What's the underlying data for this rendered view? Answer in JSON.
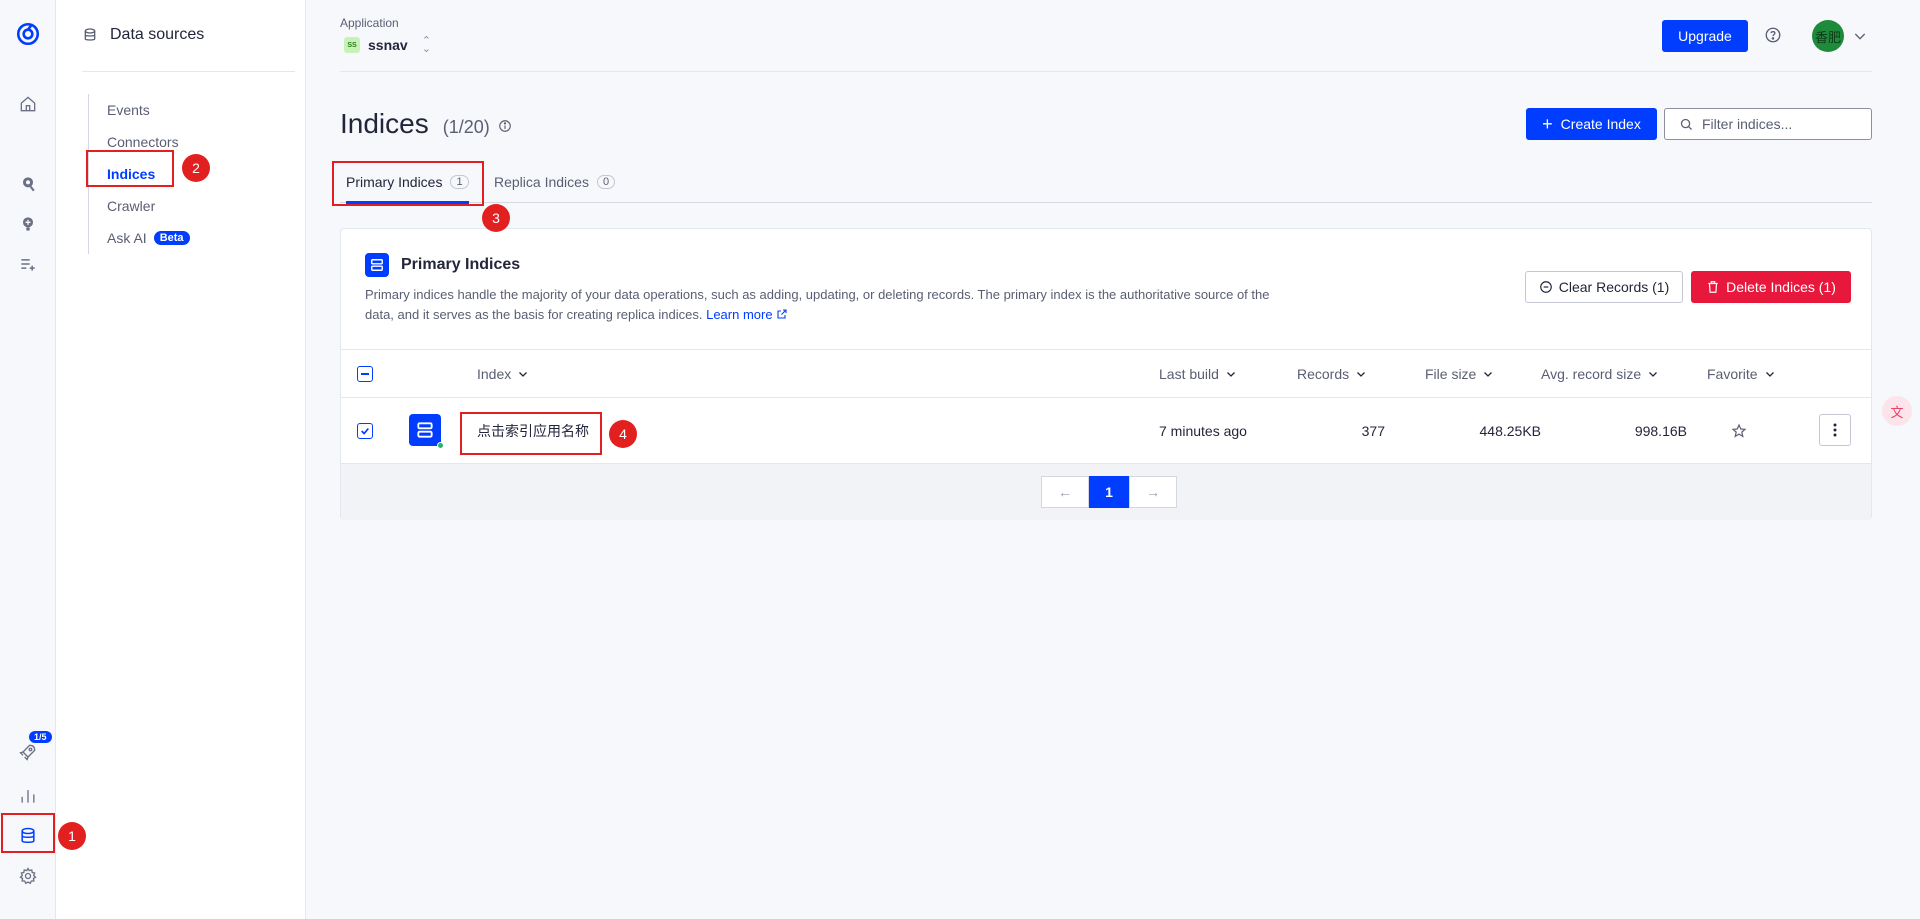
{
  "rail": {
    "icons": [
      "algolia-logo-icon",
      "home-icon",
      "search-icon",
      "bulb-icon",
      "list-add-icon",
      "rocket-icon",
      "bar-chart-icon",
      "database-icon",
      "gear-icon"
    ],
    "onboarding_badge": "1/5"
  },
  "sidebar": {
    "title": "Data sources",
    "items": [
      {
        "label": "Events"
      },
      {
        "label": "Connectors"
      },
      {
        "label": "Indices"
      },
      {
        "label": "Crawler"
      },
      {
        "label": "Ask AI",
        "badge": "Beta"
      }
    ],
    "active": "Indices"
  },
  "topbar": {
    "app_label": "Application",
    "app_chip": "SS",
    "app_name": "ssnav",
    "upgrade": "Upgrade",
    "avatar_text": "香肥"
  },
  "page": {
    "title": "Indices",
    "count": "(1/20)",
    "create_button": "Create Index",
    "filter_placeholder": "Filter indices..."
  },
  "tabs": [
    {
      "label": "Primary Indices",
      "count": "1",
      "active": true
    },
    {
      "label": "Replica Indices",
      "count": "0",
      "active": false
    }
  ],
  "card": {
    "title": "Primary Indices",
    "description": "Primary indices handle the majority of your data operations, such as adding, updating, or deleting records. The primary index is the authoritative source of the data, and it serves as the basis for creating replica indices.",
    "learn_more": "Learn more",
    "clear_button": "Clear Records (1)",
    "delete_button": "Delete Indices (1)"
  },
  "table": {
    "columns": [
      "Index",
      "Last build",
      "Records",
      "File size",
      "Avg. record size",
      "Favorite"
    ],
    "rows": [
      {
        "index": "点击索引应用名称",
        "last_build": "7 minutes ago",
        "records": "377",
        "file_size": "448.25KB",
        "avg_record_size": "998.16B",
        "checked": true
      }
    ]
  },
  "pagination": {
    "current": "1"
  },
  "annotations": [
    "1",
    "2",
    "3",
    "4"
  ],
  "colors": {
    "accent": "#003dff",
    "danger": "#e8173c",
    "annotation": "#e32020"
  }
}
